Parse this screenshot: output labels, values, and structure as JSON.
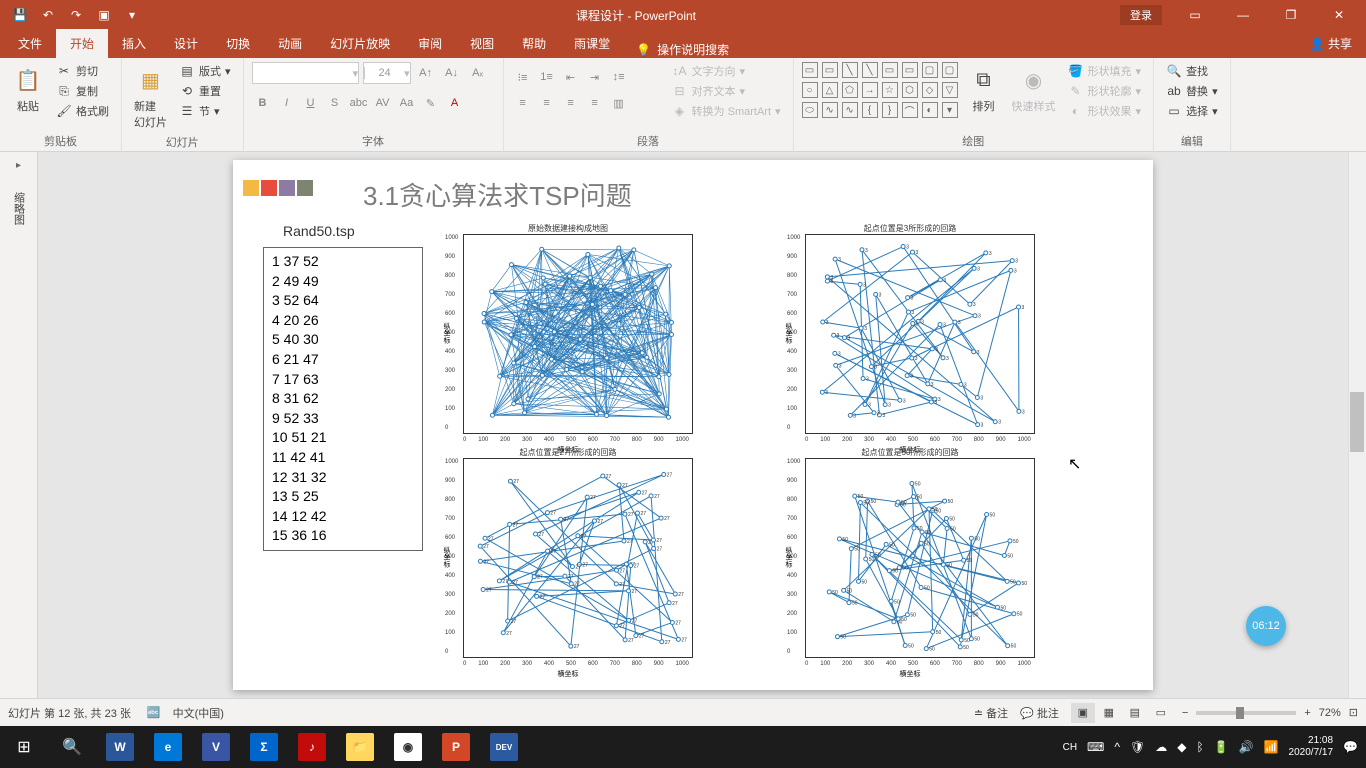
{
  "titlebar": {
    "title": "课程设计 - PowerPoint",
    "login": "登录"
  },
  "tabs": {
    "file": "文件",
    "home": "开始",
    "insert": "插入",
    "design": "设计",
    "transitions": "切换",
    "animations": "动画",
    "slideshow": "幻灯片放映",
    "review": "审阅",
    "view": "视图",
    "help": "帮助",
    "rain": "雨课堂",
    "tellme": "操作说明搜索",
    "share": "共享"
  },
  "ribbon": {
    "clipboard": {
      "label": "剪贴板",
      "paste": "粘贴",
      "cut": "剪切",
      "copy": "复制",
      "format_painter": "格式刷"
    },
    "slides": {
      "label": "幻灯片",
      "new_slide": "新建\n幻灯片",
      "layout": "版式",
      "reset": "重置",
      "section": "节"
    },
    "font": {
      "label": "字体",
      "size": "24"
    },
    "paragraph": {
      "label": "段落",
      "text_direction": "文字方向",
      "align_text": "对齐文本",
      "convert_smartart": "转换为 SmartArt"
    },
    "drawing": {
      "label": "绘图",
      "arrange": "排列",
      "quick_styles": "快速样式",
      "shape_fill": "形状填充",
      "shape_outline": "形状轮廓",
      "shape_effects": "形状效果"
    },
    "editing": {
      "label": "编辑",
      "find": "查找",
      "replace": "替换",
      "select": "选择"
    }
  },
  "side_panel": "缩略图",
  "slide": {
    "title": "3.1贪心算法求TSP问题",
    "data_label": "Rand50.tsp",
    "data_rows": [
      "1 37 52",
      "2 49 49",
      "3 52 64",
      "4 20 26",
      "5 40 30",
      "6 21 47",
      "7 17 63",
      "8 31 62",
      "9 52 33",
      "10 51 21",
      "11 42 41",
      "12 31 32",
      "13 5 25",
      "14 12 42",
      "15 36 16"
    ],
    "chart_titles": [
      "原始数据建接构成地图",
      "起点位置是3所形成的回路",
      "起点位置是27所形成的回路",
      "起点位置是50所形成的回路"
    ],
    "axis_label_x": "横坐标",
    "axis_label_y": "纵坐标",
    "ticks": [
      "0",
      "100",
      "200",
      "300",
      "400",
      "500",
      "600",
      "700",
      "800",
      "900",
      "1000"
    ]
  },
  "chart_data": [
    {
      "type": "scatter",
      "title": "原始数据建接构成地图",
      "xlim": [
        0,
        1000
      ],
      "ylim": [
        0,
        1000
      ],
      "xlabel": "横坐标",
      "ylabel": "纵坐标",
      "note": "dense random connections of 50 TSP nodes"
    },
    {
      "type": "line",
      "title": "起点位置是3所形成的回路",
      "xlim": [
        0,
        1000
      ],
      "ylim": [
        0,
        1000
      ],
      "xlabel": "横坐标",
      "ylabel": "纵坐标",
      "label": "3"
    },
    {
      "type": "line",
      "title": "起点位置是27所形成的回路",
      "xlim": [
        0,
        1000
      ],
      "ylim": [
        0,
        1000
      ],
      "xlabel": "横坐标",
      "ylabel": "纵坐标",
      "label": "27"
    },
    {
      "type": "line",
      "title": "起点位置是50所形成的回路",
      "xlim": [
        0,
        1000
      ],
      "ylim": [
        0,
        1000
      ],
      "xlabel": "横坐标",
      "ylabel": "纵坐标",
      "label": "50"
    }
  ],
  "statusbar": {
    "slide_info": "幻灯片 第 12 张, 共 23 张",
    "language": "中文(中国)",
    "notes": "备注",
    "comments": "批注",
    "zoom": "72%"
  },
  "timer": "06:12",
  "taskbar": {
    "ime": "CH",
    "time": "21:08",
    "date": "2020/7/17"
  }
}
